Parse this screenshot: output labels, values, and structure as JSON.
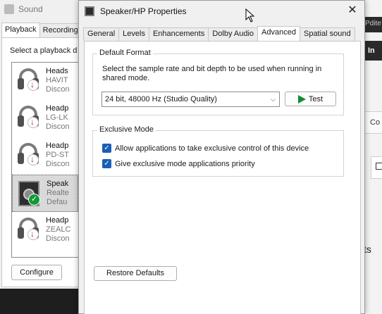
{
  "background_app": {
    "fragment_top": "Pdite",
    "fragment_in": "In",
    "fragment_frame": "Co",
    "fragment_bottom": "ts"
  },
  "sound_dialog": {
    "title": "Sound",
    "tabs": [
      {
        "label": "Playback",
        "selected": true
      },
      {
        "label": "Recording",
        "selected": false
      }
    ],
    "select_label": "Select a playback d",
    "devices": [
      {
        "name": "Heads",
        "line2": "HAVIT",
        "line3": "Discon",
        "icon": "headphones-icon",
        "status": "disconnected"
      },
      {
        "name": "Headp",
        "line2": "LG-LK",
        "line3": "Discon",
        "icon": "headphones-icon",
        "status": "disconnected"
      },
      {
        "name": "Headp",
        "line2": "PD-ST",
        "line3": "Discon",
        "icon": "headphones-icon",
        "status": "disconnected"
      },
      {
        "name": "Speak",
        "line2": "Realte",
        "line3": "Defau",
        "icon": "speaker-icon",
        "status": "default",
        "selected": true
      },
      {
        "name": "Headp",
        "line2": "ZEALC",
        "line3": "Discon",
        "icon": "headphones-icon",
        "status": "disconnected"
      }
    ],
    "configure_label": "Configure"
  },
  "properties_dialog": {
    "title": "Speaker/HP Properties",
    "close_label": "✕",
    "tabs": [
      {
        "label": "General",
        "selected": false
      },
      {
        "label": "Levels",
        "selected": false
      },
      {
        "label": "Enhancements",
        "selected": false
      },
      {
        "label": "Dolby Audio",
        "selected": false
      },
      {
        "label": "Advanced",
        "selected": true
      },
      {
        "label": "Spatial sound",
        "selected": false
      }
    ],
    "default_format": {
      "group_label": "Default Format",
      "description": "Select the sample rate and bit depth to be used when running in shared mode.",
      "selected_format": "24 bit, 48000 Hz (Studio Quality)",
      "test_label": "Test"
    },
    "exclusive_mode": {
      "group_label": "Exclusive Mode",
      "options": [
        {
          "label": "Allow applications to take exclusive control of this device",
          "checked": true
        },
        {
          "label": "Give exclusive mode applications priority",
          "checked": true
        }
      ]
    },
    "restore_label": "Restore Defaults"
  },
  "colors": {
    "accent": "#1a5fb4",
    "play_green": "#178a34",
    "default_badge": "#119a38",
    "disconnected_badge": "#d01c1c"
  }
}
